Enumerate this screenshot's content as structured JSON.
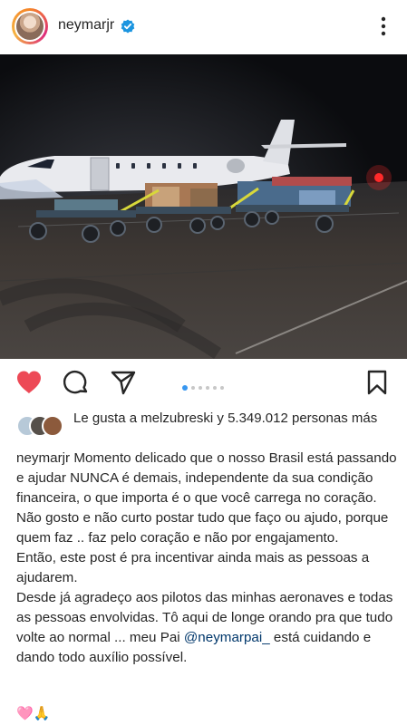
{
  "header": {
    "username": "neymarjr",
    "icons": [
      "avatar",
      "verified-badge-icon",
      "more-vert-icon"
    ]
  },
  "post": {
    "carousel": {
      "count": 6,
      "active_index": 0
    },
    "actions": [
      "heart-icon",
      "comment-icon",
      "share-icon",
      "bookmark-icon"
    ],
    "liked": true,
    "colors": {
      "like_red": "#ed4956",
      "dot_blue": "#3897f0",
      "mention_blue": "#00376b"
    }
  },
  "likes": {
    "text": "Le gusta a melzubreski y 5.349.012 personas más"
  },
  "caption": {
    "username": "neymarjr",
    "p1": "Momento delicado que o nosso Brasil está passando e ajudar NUNCA é demais, independente da sua condição financeira, o que importa é o que você carrega no coração.",
    "p2": "Não gosto e não curto postar tudo que faço ou ajudo, porque quem faz .. faz pelo coração e não por engajamento.",
    "p3": "Então, este post é pra incentivar ainda mais as pessoas a ajudarem.",
    "p4_before": "Desde já agradeço aos pilotos das minhas aeronaves e todas as pessoas envolvidas. Tô aqui de longe orando pra que tudo volte ao normal ... meu Pai",
    "mention": "@neymarpai_",
    "p4_after": "está cuidando e dando todo auxílio possível.",
    "emoji": "🩷🙏"
  }
}
